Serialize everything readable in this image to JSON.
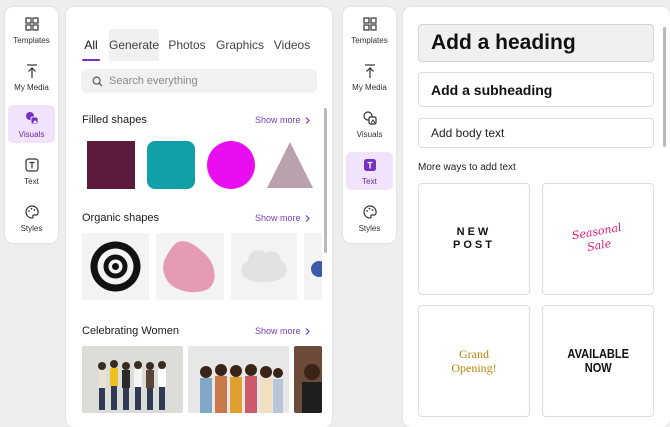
{
  "left_rail": {
    "items": [
      {
        "label": "Templates",
        "icon": "templates-icon"
      },
      {
        "label": "My Media",
        "icon": "upload-icon"
      },
      {
        "label": "Visuals",
        "icon": "visuals-icon",
        "active": true
      },
      {
        "label": "Text",
        "icon": "text-icon"
      },
      {
        "label": "Styles",
        "icon": "palette-icon"
      }
    ]
  },
  "visuals_panel": {
    "tabs": [
      "All",
      "Generate",
      "Photos",
      "Graphics",
      "Videos"
    ],
    "active_tab": "All",
    "search": {
      "placeholder": "Search everything"
    },
    "sections": [
      {
        "title": "Filled shapes",
        "show_more": "Show more"
      },
      {
        "title": "Organic shapes",
        "show_more": "Show more"
      },
      {
        "title": "Celebrating Women",
        "show_more": "Show more"
      }
    ],
    "colors": {
      "square": "#5b1a3e",
      "rounded_square": "#10a1a8",
      "circle": "#ea0df0",
      "triangle": "#b9a2ae",
      "blob": "#e59bb6",
      "cloud": "#e2e2e2"
    }
  },
  "right_rail": {
    "items": [
      {
        "label": "Templates",
        "icon": "templates-icon"
      },
      {
        "label": "My Media",
        "icon": "upload-icon"
      },
      {
        "label": "Visuals",
        "icon": "visuals-icon"
      },
      {
        "label": "Text",
        "icon": "text-icon",
        "active": true
      },
      {
        "label": "Styles",
        "icon": "palette-icon"
      }
    ]
  },
  "text_panel": {
    "heading": "Add a heading",
    "subheading": "Add a subheading",
    "body": "Add body text",
    "more_ways": "More ways to add text",
    "templates": [
      {
        "line1": "NEW",
        "line2": "POST"
      },
      {
        "line1": "Seasonal",
        "line2": "Sale"
      },
      {
        "line1": "Grand",
        "line2": "Opening!"
      },
      {
        "line1": "AVAILABLE",
        "line2": "NOW"
      }
    ]
  },
  "accent_color": "#7a2fc3"
}
